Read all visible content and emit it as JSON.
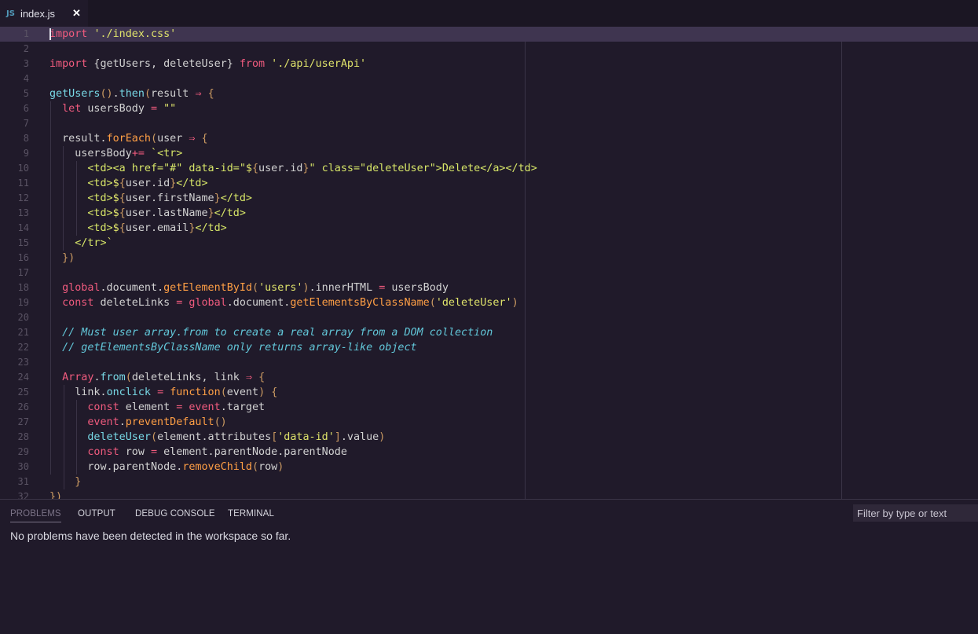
{
  "tab": {
    "icon": "JS",
    "label": "index.js",
    "close_icon": "✕"
  },
  "editor": {
    "lines": [
      {
        "n": "1",
        "tokens": [
          [
            "k",
            "import"
          ],
          [
            "p",
            " "
          ],
          [
            "s",
            "'./index.css'"
          ]
        ]
      },
      {
        "n": "2",
        "tokens": []
      },
      {
        "n": "3",
        "tokens": [
          [
            "k",
            "import"
          ],
          [
            "p",
            " {getUsers, deleteUser} "
          ],
          [
            "k",
            "from"
          ],
          [
            "p",
            " "
          ],
          [
            "s",
            "'./api/userApi'"
          ]
        ]
      },
      {
        "n": "4",
        "tokens": []
      },
      {
        "n": "5",
        "tokens": [
          [
            "f",
            "getUsers"
          ],
          [
            "b",
            "()"
          ],
          [
            "p",
            "."
          ],
          [
            "f",
            "then"
          ],
          [
            "b",
            "("
          ],
          [
            "p",
            "result "
          ],
          [
            "k",
            "⇒"
          ],
          [
            "p",
            " "
          ],
          [
            "b",
            "{"
          ]
        ]
      },
      {
        "n": "6",
        "tokens": [
          [
            "p",
            "  "
          ],
          [
            "k",
            "let"
          ],
          [
            "p",
            " usersBody "
          ],
          [
            "k",
            "="
          ],
          [
            "p",
            " "
          ],
          [
            "s",
            "\"\""
          ]
        ]
      },
      {
        "n": "7",
        "tokens": []
      },
      {
        "n": "8",
        "tokens": [
          [
            "p",
            "  result."
          ],
          [
            "m",
            "forEach"
          ],
          [
            "b",
            "("
          ],
          [
            "p",
            "user "
          ],
          [
            "k",
            "⇒"
          ],
          [
            "p",
            " "
          ],
          [
            "b",
            "{"
          ]
        ]
      },
      {
        "n": "9",
        "tokens": [
          [
            "p",
            "    usersBody"
          ],
          [
            "k",
            "+="
          ],
          [
            "p",
            " "
          ],
          [
            "s",
            "`"
          ],
          [
            "tg",
            "<tr>"
          ]
        ]
      },
      {
        "n": "10",
        "tokens": [
          [
            "p",
            "      "
          ],
          [
            "tg",
            "<td><a href=\"#\" data-id=\""
          ],
          [
            "s",
            "$"
          ],
          [
            "b",
            "{"
          ],
          [
            "p",
            "user.id"
          ],
          [
            "b",
            "}"
          ],
          [
            "tg",
            "\" class=\"deleteUser\">Delete</a></td>"
          ]
        ]
      },
      {
        "n": "11",
        "tokens": [
          [
            "p",
            "      "
          ],
          [
            "tg",
            "<td>"
          ],
          [
            "s",
            "$"
          ],
          [
            "b",
            "{"
          ],
          [
            "p",
            "user.id"
          ],
          [
            "b",
            "}"
          ],
          [
            "tg",
            "</td>"
          ]
        ]
      },
      {
        "n": "12",
        "tokens": [
          [
            "p",
            "      "
          ],
          [
            "tg",
            "<td>"
          ],
          [
            "s",
            "$"
          ],
          [
            "b",
            "{"
          ],
          [
            "p",
            "user.firstName"
          ],
          [
            "b",
            "}"
          ],
          [
            "tg",
            "</td>"
          ]
        ]
      },
      {
        "n": "13",
        "tokens": [
          [
            "p",
            "      "
          ],
          [
            "tg",
            "<td>"
          ],
          [
            "s",
            "$"
          ],
          [
            "b",
            "{"
          ],
          [
            "p",
            "user.lastName"
          ],
          [
            "b",
            "}"
          ],
          [
            "tg",
            "</td>"
          ]
        ]
      },
      {
        "n": "14",
        "tokens": [
          [
            "p",
            "      "
          ],
          [
            "tg",
            "<td>"
          ],
          [
            "s",
            "$"
          ],
          [
            "b",
            "{"
          ],
          [
            "p",
            "user.email"
          ],
          [
            "b",
            "}"
          ],
          [
            "tg",
            "</td>"
          ]
        ]
      },
      {
        "n": "15",
        "tokens": [
          [
            "p",
            "    "
          ],
          [
            "tg",
            "</tr>"
          ],
          [
            "s",
            "`"
          ]
        ]
      },
      {
        "n": "16",
        "tokens": [
          [
            "p",
            "  "
          ],
          [
            "b",
            "})"
          ]
        ]
      },
      {
        "n": "17",
        "tokens": []
      },
      {
        "n": "18",
        "tokens": [
          [
            "p",
            "  "
          ],
          [
            "g",
            "global"
          ],
          [
            "p",
            ".document."
          ],
          [
            "m",
            "getElementById"
          ],
          [
            "b",
            "("
          ],
          [
            "s",
            "'users'"
          ],
          [
            "b",
            ")"
          ],
          [
            "p",
            ".innerHTML "
          ],
          [
            "k",
            "="
          ],
          [
            "p",
            " usersBody"
          ]
        ]
      },
      {
        "n": "19",
        "tokens": [
          [
            "p",
            "  "
          ],
          [
            "k",
            "const"
          ],
          [
            "p",
            " deleteLinks "
          ],
          [
            "k",
            "="
          ],
          [
            "p",
            " "
          ],
          [
            "g",
            "global"
          ],
          [
            "p",
            ".document."
          ],
          [
            "m",
            "getElementsByClassName"
          ],
          [
            "b",
            "("
          ],
          [
            "s",
            "'deleteUser'"
          ],
          [
            "b",
            ")"
          ]
        ]
      },
      {
        "n": "20",
        "tokens": []
      },
      {
        "n": "21",
        "tokens": [
          [
            "p",
            "  "
          ],
          [
            "c",
            "// Must user array.from to create a real array from a DOM collection"
          ]
        ]
      },
      {
        "n": "22",
        "tokens": [
          [
            "p",
            "  "
          ],
          [
            "c",
            "// getElementsByClassName only returns array-like object"
          ]
        ]
      },
      {
        "n": "23",
        "tokens": []
      },
      {
        "n": "24",
        "tokens": [
          [
            "p",
            "  "
          ],
          [
            "g",
            "Array"
          ],
          [
            "p",
            "."
          ],
          [
            "f",
            "from"
          ],
          [
            "b",
            "("
          ],
          [
            "p",
            "deleteLinks, link "
          ],
          [
            "k",
            "⇒"
          ],
          [
            "p",
            " "
          ],
          [
            "b",
            "{"
          ]
        ]
      },
      {
        "n": "25",
        "tokens": [
          [
            "p",
            "    link."
          ],
          [
            "f",
            "onclick"
          ],
          [
            "p",
            " "
          ],
          [
            "k",
            "="
          ],
          [
            "p",
            " "
          ],
          [
            "m",
            "function"
          ],
          [
            "b",
            "("
          ],
          [
            "p",
            "event"
          ],
          [
            "b",
            ")"
          ],
          [
            "p",
            " "
          ],
          [
            "b",
            "{"
          ]
        ]
      },
      {
        "n": "26",
        "tokens": [
          [
            "p",
            "      "
          ],
          [
            "k",
            "const"
          ],
          [
            "p",
            " element "
          ],
          [
            "k",
            "="
          ],
          [
            "p",
            " "
          ],
          [
            "g",
            "event"
          ],
          [
            "p",
            ".target"
          ]
        ]
      },
      {
        "n": "27",
        "tokens": [
          [
            "p",
            "      "
          ],
          [
            "g",
            "event"
          ],
          [
            "p",
            "."
          ],
          [
            "m",
            "preventDefault"
          ],
          [
            "b",
            "()"
          ]
        ]
      },
      {
        "n": "28",
        "tokens": [
          [
            "p",
            "      "
          ],
          [
            "f",
            "deleteUser"
          ],
          [
            "b",
            "("
          ],
          [
            "p",
            "element.attributes"
          ],
          [
            "b",
            "["
          ],
          [
            "s",
            "'data-id'"
          ],
          [
            "b",
            "]"
          ],
          [
            "p",
            ".value"
          ],
          [
            "b",
            ")"
          ]
        ]
      },
      {
        "n": "29",
        "tokens": [
          [
            "p",
            "      "
          ],
          [
            "k",
            "const"
          ],
          [
            "p",
            " row "
          ],
          [
            "k",
            "="
          ],
          [
            "p",
            " element.parentNode.parentNode"
          ]
        ]
      },
      {
        "n": "30",
        "tokens": [
          [
            "p",
            "      row.parentNode."
          ],
          [
            "m",
            "removeChild"
          ],
          [
            "b",
            "("
          ],
          [
            "p",
            "row"
          ],
          [
            "b",
            ")"
          ]
        ]
      },
      {
        "n": "31",
        "tokens": [
          [
            "p",
            "    "
          ],
          [
            "b",
            "}"
          ]
        ]
      },
      {
        "n": "32",
        "tokens": [
          [
            "b",
            "})"
          ]
        ]
      }
    ]
  },
  "panel": {
    "tabs": [
      "PROBLEMS",
      "OUTPUT",
      "DEBUG CONSOLE",
      "TERMINAL"
    ],
    "filter_placeholder": "Filter by type or text",
    "message": "No problems have been detected in the workspace so far."
  }
}
